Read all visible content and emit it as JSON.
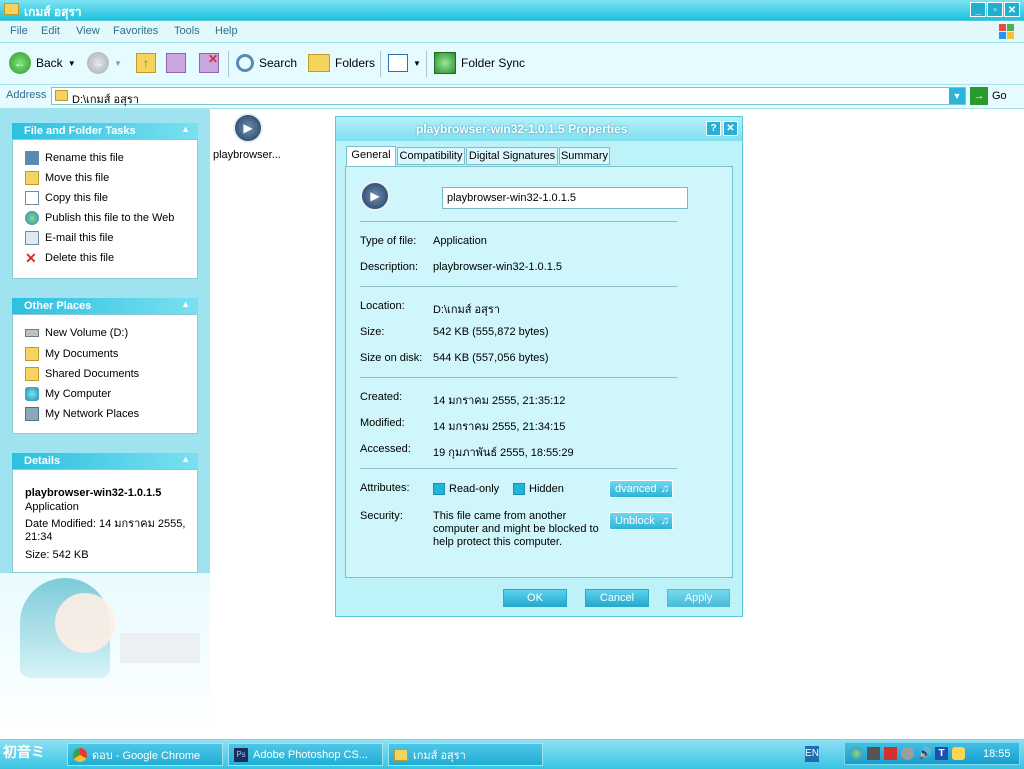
{
  "window": {
    "title": "เกมส์ อสุรา"
  },
  "menu": [
    "File",
    "Edit",
    "View",
    "Favorites",
    "Tools",
    "Help"
  ],
  "toolbar": {
    "back_label": "Back",
    "search_label": "Search",
    "folders_label": "Folders",
    "sync_label": "Folder Sync"
  },
  "address": {
    "label": "Address",
    "value": "D:\\เกมส์ อสุรา",
    "go_label": "Go"
  },
  "left_pane": {
    "file_tasks": {
      "title": "File and Folder Tasks",
      "items": [
        "Rename this file",
        "Move this file",
        "Copy this file",
        "Publish this file to the Web",
        "E-mail this file",
        "Delete this file"
      ]
    },
    "other_places": {
      "title": "Other Places",
      "items": [
        "New Volume (D:)",
        "My Documents",
        "Shared Documents",
        "My Computer",
        "My Network Places"
      ]
    },
    "details": {
      "title": "Details",
      "name": "playbrowser-win32-1.0.1.5",
      "type": "Application",
      "modified": "Date Modified: 14 มกราคม 2555, 21:34",
      "size": "Size: 542 KB"
    }
  },
  "content": {
    "file_label": "playbrowser..."
  },
  "dialog": {
    "title": "playbrowser-win32-1.0.1.5 Properties",
    "tabs": [
      "General",
      "Compatibility",
      "Digital Signatures",
      "Summary"
    ],
    "filename": "playbrowser-win32-1.0.1.5",
    "rows": {
      "type_label": "Type of file:",
      "type_value": "Application",
      "desc_label": "Description:",
      "desc_value": "playbrowser-win32-1.0.1.5",
      "location_label": "Location:",
      "location_value": "D:\\เกมส์ อสุรา",
      "size_label": "Size:",
      "size_value": "542 KB (555,872 bytes)",
      "sizeondisk_label": "Size on disk:",
      "sizeondisk_value": "544 KB (557,056 bytes)",
      "created_label": "Created:",
      "created_value": "14 มกราคม 2555, 21:35:12",
      "modified_label": "Modified:",
      "modified_value": "14 มกราคม 2555, 21:34:15",
      "accessed_label": "Accessed:",
      "accessed_value": "19 กุมภาพันธ์ 2555, 18:55:29",
      "attributes_label": "Attributes:",
      "readonly_label": "Read-only",
      "hidden_label": "Hidden",
      "advanced_label": "dvanced",
      "security_label": "Security:",
      "security_text": "This file came from another computer and might be blocked to help protect this computer.",
      "unblock_label": "Unblock"
    },
    "buttons": {
      "ok": "OK",
      "cancel": "Cancel",
      "apply": "Apply"
    }
  },
  "taskbar": {
    "items": [
      {
        "label": "ดอบ - Google Chrome"
      },
      {
        "label": "Adobe Photoshop CS..."
      },
      {
        "label": "เกมส์ อสุรา"
      }
    ],
    "lang": "EN",
    "clock": "18:55"
  },
  "colors": {
    "accent": "#22b5db",
    "pane": "#9fe3f0",
    "dialog_bg": "#bdf3f8"
  }
}
